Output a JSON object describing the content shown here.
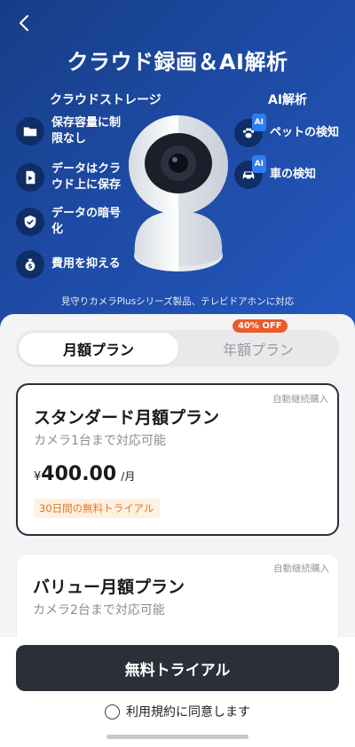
{
  "header": {
    "title": "クラウド録画＆AI解析"
  },
  "cloud_storage": {
    "title": "クラウドストレージ",
    "features": [
      {
        "icon": "folder-icon",
        "label_line1": "保存容量に制",
        "label_line2": "限なし"
      },
      {
        "icon": "sd-card-icon",
        "label_line1": "データはクラ",
        "label_line2": "ウド上に保存"
      },
      {
        "icon": "shield-check-icon",
        "label_line1": "データの暗号",
        "label_line2": "化"
      },
      {
        "icon": "money-bag-icon",
        "label_line1": "費用を抑える",
        "label_line2": ""
      }
    ]
  },
  "ai_analysis": {
    "title": "AI解析",
    "features": [
      {
        "icon": "paw-icon",
        "badge": "AI",
        "label": "ペットの検知"
      },
      {
        "icon": "car-icon",
        "badge": "AI",
        "label": "車の検知"
      }
    ]
  },
  "hero_note": "見守りカメラPlusシリーズ製品、テレビドアホンに対応",
  "tabs": {
    "monthly": "月額プラン",
    "yearly": "年額プラン",
    "yearly_badge": "40% OFF"
  },
  "plans": [
    {
      "auto_renew": "自動継続購入",
      "name": "スタンダード月額プラン",
      "desc": "カメラ1台まで対応可能",
      "currency": "¥",
      "price": "400.00",
      "unit": "/月",
      "trial": "30日間の無料トライアル"
    },
    {
      "auto_renew": "自動継続購入",
      "name": "バリュー月額プラン",
      "desc": "カメラ2台まで対応可能"
    }
  ],
  "cta": {
    "label": "無料トライアル"
  },
  "agreement": {
    "label": "利用規約に同意します"
  },
  "colors": {
    "hero_start": "#163d86",
    "hero_end": "#2458bf",
    "cta": "#2b2f37",
    "badge": "#ea5a2b",
    "trial_bg": "#fff1e2",
    "trial_text": "#e07a1f"
  }
}
